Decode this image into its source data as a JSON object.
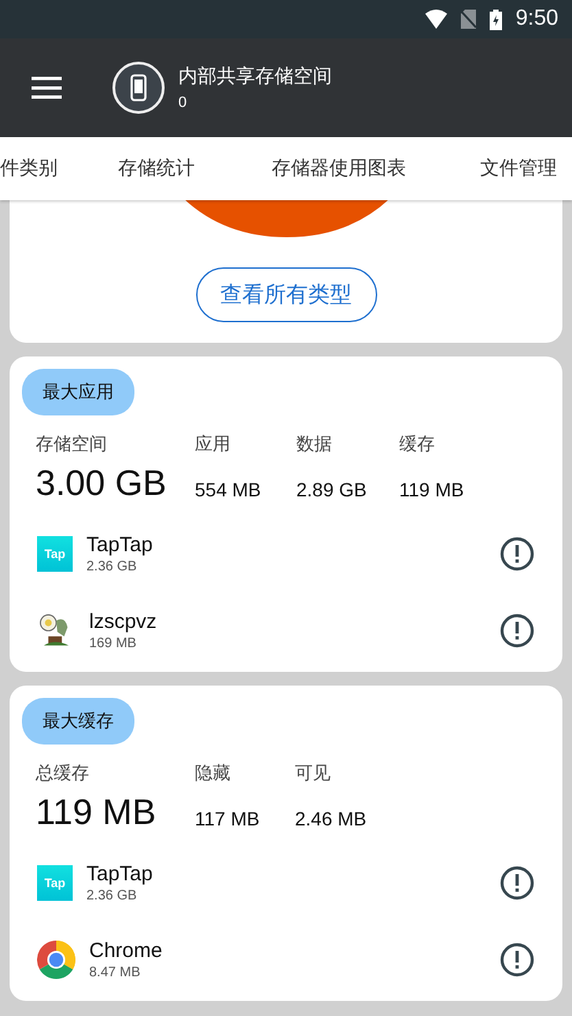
{
  "status_bar": {
    "time": "9:50"
  },
  "app_bar": {
    "title": "内部共享存储空间",
    "subtitle": "0"
  },
  "tabs": [
    {
      "label": "件类别"
    },
    {
      "label": "存储统计"
    },
    {
      "label": "存储器使用图表"
    },
    {
      "label": "文件管理"
    }
  ],
  "chart_card": {
    "button": "查看所有类型"
  },
  "sections": [
    {
      "badge": "最大应用",
      "stats": [
        {
          "label": "存储空间",
          "value": "3.00 GB"
        },
        {
          "label": "应用",
          "value": "554 MB"
        },
        {
          "label": "数据",
          "value": "2.89 GB"
        },
        {
          "label": "缓存",
          "value": "119 MB"
        }
      ],
      "apps": [
        {
          "kind": "taptap",
          "icon_text": "Tap",
          "name": "TapTap",
          "size": "2.36 GB"
        },
        {
          "kind": "plant",
          "name": "lzscpvz",
          "size": "169 MB"
        }
      ]
    },
    {
      "badge": "最大缓存",
      "stats": [
        {
          "label": "总缓存",
          "value": "119 MB"
        },
        {
          "label": "隐藏",
          "value": "117 MB"
        },
        {
          "label": "可见",
          "value": "2.46 MB"
        }
      ],
      "apps": [
        {
          "kind": "taptap",
          "icon_text": "Tap",
          "name": "TapTap",
          "size": "2.36 GB"
        },
        {
          "kind": "chrome",
          "name": "Chrome",
          "size": "8.47 MB"
        }
      ]
    }
  ]
}
